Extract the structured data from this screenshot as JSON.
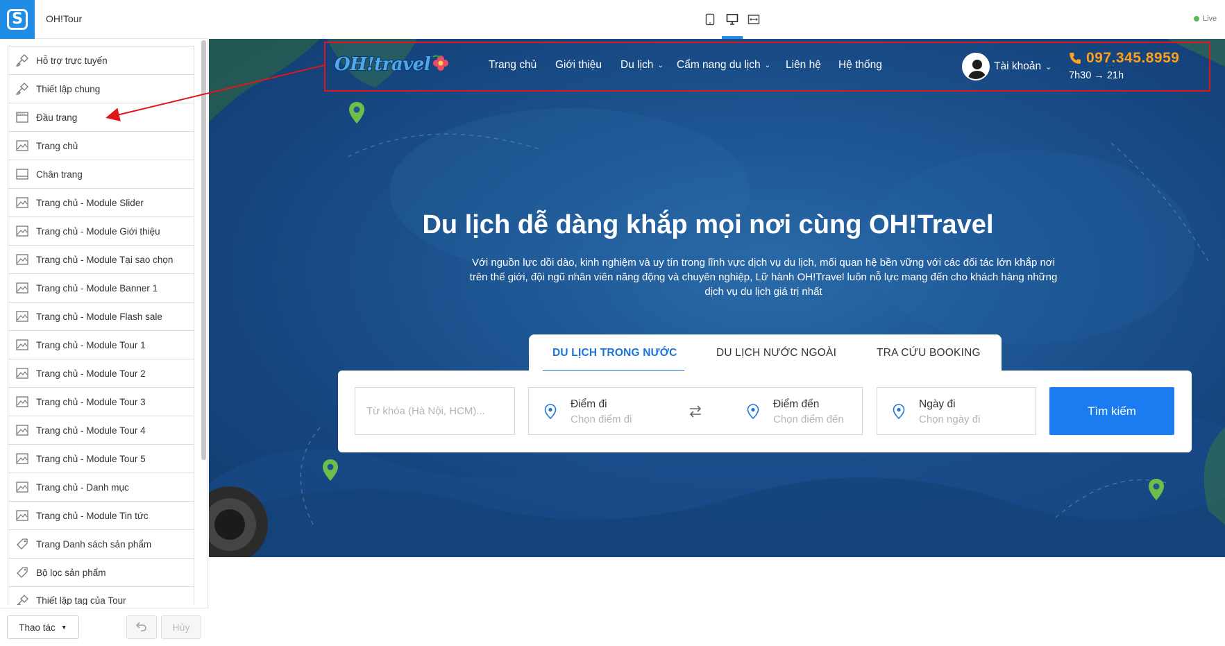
{
  "app": {
    "site_name": "OH!Tour"
  },
  "sidebar": {
    "items": [
      {
        "label": "Hỗ trợ trực tuyến",
        "icon": "brush-icon"
      },
      {
        "label": "Thiết lập chung",
        "icon": "brush-icon"
      },
      {
        "label": "Đầu trang",
        "icon": "header-layout-icon"
      },
      {
        "label": "Trang chủ",
        "icon": "image-icon"
      },
      {
        "label": "Chân trang",
        "icon": "footer-layout-icon"
      },
      {
        "label": "Trang chủ - Module Slider",
        "icon": "image-icon"
      },
      {
        "label": "Trang chủ - Module Giới thiệu",
        "icon": "image-icon"
      },
      {
        "label": "Trang chủ - Module Tại sao chọn",
        "icon": "image-icon"
      },
      {
        "label": "Trang chủ - Module Banner 1",
        "icon": "image-icon"
      },
      {
        "label": "Trang chủ - Module Flash sale",
        "icon": "image-icon"
      },
      {
        "label": "Trang chủ - Module Tour 1",
        "icon": "image-icon"
      },
      {
        "label": "Trang chủ - Module Tour 2",
        "icon": "image-icon"
      },
      {
        "label": "Trang chủ - Module Tour 3",
        "icon": "image-icon"
      },
      {
        "label": "Trang chủ - Module Tour 4",
        "icon": "image-icon"
      },
      {
        "label": "Trang chủ - Module Tour 5",
        "icon": "image-icon"
      },
      {
        "label": "Trang chủ - Danh mục",
        "icon": "image-icon"
      },
      {
        "label": "Trang chủ - Module Tin tức",
        "icon": "image-icon"
      },
      {
        "label": "Trang Danh sách sản phẩm",
        "icon": "tag-icon"
      },
      {
        "label": "Bộ lọc sản phẩm",
        "icon": "tag-icon"
      },
      {
        "label": "Thiết lập tag của Tour",
        "icon": "brush-icon"
      }
    ],
    "footer": {
      "action_label": "Thao tác",
      "cancel_label": "Hủy"
    }
  },
  "toolbar": {
    "live_label": "Live"
  },
  "preview": {
    "brand": "OH!travel",
    "nav": [
      {
        "label": "Trang chủ",
        "dropdown": false
      },
      {
        "label": "Giới thiệu",
        "dropdown": false
      },
      {
        "label": "Du lịch",
        "dropdown": true
      },
      {
        "label": "Cẩm nang du lịch",
        "dropdown": true
      },
      {
        "label": "Liên hệ",
        "dropdown": false
      },
      {
        "label": "Hệ thống",
        "dropdown": false
      }
    ],
    "account_label": "Tài khoản",
    "phone": "097.345.8959",
    "hours": "7h30 → 21h",
    "hero_title": "Du lịch dễ dàng khắp mọi nơi cùng OH!Travel",
    "hero_desc_lines": [
      "Với nguồn lực dồi dào, kinh nghiệm và uy tín trong lĩnh vực dịch vụ du lịch, mối quan hệ bền vững với các đối tác lớn khắp nơi",
      "trên thế giới, đội ngũ nhân viên năng động và chuyên nghiệp, Lữ hành OH!Travel luôn nỗ lực mang đến cho khách hàng những",
      "dịch vụ du lịch giá trị nhất"
    ],
    "tabs": [
      "DU LỊCH TRONG NƯỚC",
      "DU LỊCH NƯỚC NGOÀI",
      "TRA CỨU BOOKING"
    ],
    "search": {
      "keyword_placeholder": "Từ khóa (Hà Nội, HCM)...",
      "from_label": "Điểm đi",
      "from_placeholder": "Chọn điểm đi",
      "to_label": "Điểm đến",
      "to_placeholder": "Chọn điểm đến",
      "date_label": "Ngày đi",
      "date_placeholder": "Chọn ngày đi",
      "button_label": "Tìm kiếm"
    }
  },
  "colors": {
    "accent": "#1f8ce6",
    "search_button": "#1a7cf0",
    "phone": "#ff9f1a",
    "highlight_box": "#e0161d",
    "pin": "#6cc04a"
  }
}
